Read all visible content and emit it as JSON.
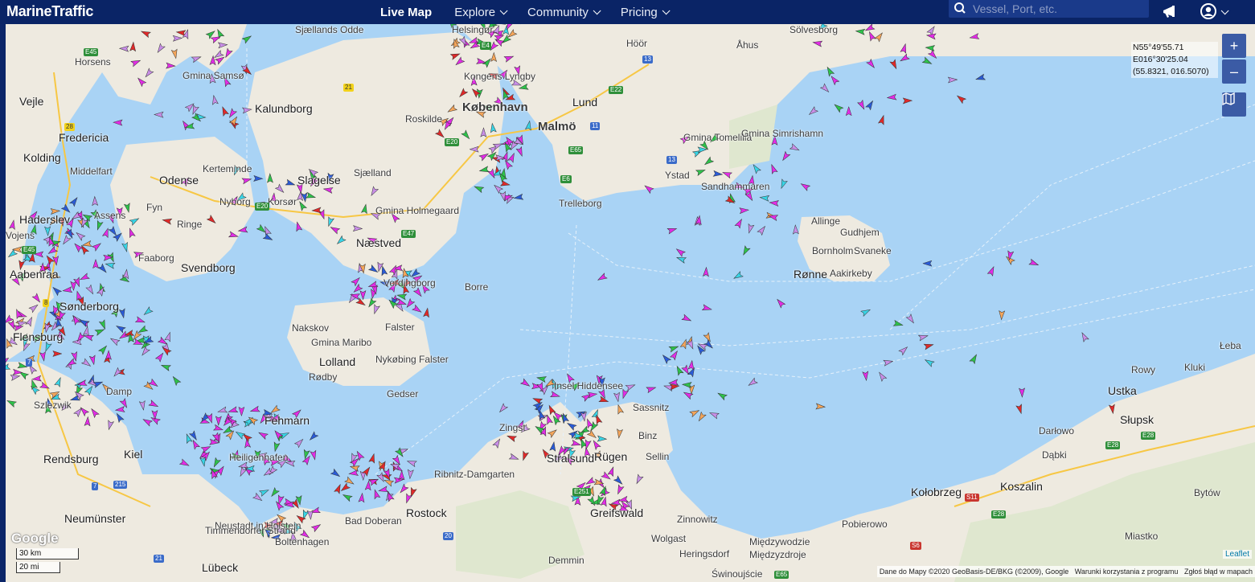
{
  "header": {
    "logo": "MarineTraffic",
    "nav": [
      {
        "label": "Live Map",
        "active": true,
        "caret": false
      },
      {
        "label": "Explore",
        "active": false,
        "caret": true
      },
      {
        "label": "Community",
        "active": false,
        "caret": true
      },
      {
        "label": "Pricing",
        "active": false,
        "caret": true
      }
    ],
    "search_placeholder": "Vessel, Port, etc."
  },
  "map_controls": {
    "zoom_in": "+",
    "zoom_out": "–"
  },
  "coordinates": {
    "lat": "N55°49'55.71",
    "lon": "E016°30'25.04",
    "decimal": "(55.8321, 016.5070)"
  },
  "scale": {
    "km": "30 km",
    "mi": "20 mi"
  },
  "attribution": {
    "data": "Dane do Mapy ©2020 GeoBasis-DE/BKG (©2009), Google",
    "terms": "Warunki korzystania z programu",
    "report": "Zgłoś błąd w mapach",
    "leaflet": "Leaflet",
    "google": "Google"
  },
  "places": [
    "Horsens",
    "Vejle",
    "Fredericia",
    "Kolding",
    "Middelfart",
    "Haderslev",
    "Aabenraa",
    "Sønderborg",
    "Flensburg",
    "Vojens",
    "Odense",
    "Fyn",
    "Nyborg",
    "Ringe",
    "Faaborg",
    "Svendborg",
    "Assens",
    "Kerteminde",
    "Kalundborg",
    "Slagelse",
    "Sjælland",
    "Korsør",
    "Næstved",
    "Gmina Holmegaard",
    "Roskilde",
    "København",
    "Kongens Lyngby",
    "Helsingør",
    "Gmina Samsø",
    "Sjællands Odde",
    "Vordingborg",
    "Falster",
    "Nakskov",
    "Lolland",
    "Gmina Maribo",
    "Nykøbing Falster",
    "Rødby",
    "Borre",
    "Gedser",
    "Malmö",
    "Lund",
    "Trelleborg",
    "Ystad",
    "Gmina Tomelilla",
    "Gmina Simrishamn",
    "Sandhammaren",
    "Höör",
    "Åhus",
    "Sölvesborg",
    "Bornholm",
    "Rønne",
    "Aakirkeby",
    "Svaneke",
    "Allinge",
    "Gudhjem",
    "Rendsburg",
    "Neumünster",
    "Kiel",
    "Szlezwik",
    "Damp",
    "Fehmarn",
    "Heiligenhafen",
    "Neustadt in Holstein",
    "Timmendorfer Strand",
    "Lübeck",
    "Boltenhagen",
    "Rostock",
    "Bad Doberan",
    "Ribnitz-Damgarten",
    "Zingst",
    "Stralsund",
    "Rügen",
    "Insel Hiddensee",
    "Sassnitz",
    "Binz",
    "Sellin",
    "Greifswald",
    "Wolgast",
    "Zinnowitz",
    "Heringsdorf",
    "Demmin",
    "Świnoujście",
    "Międzyzdroje",
    "Międzywodzie",
    "Pobierowo",
    "Kołobrzeg",
    "Koszalin",
    "Darłowo",
    "Dąbki",
    "Słupsk",
    "Ustka",
    "Rowy",
    "Kluki",
    "Łeba",
    "Bytów",
    "Miastko",
    "Sassnitz"
  ],
  "colors": {
    "header": "#0a2466",
    "sea": "#a9d3f5",
    "land": "#eeeae0",
    "cargo": "#2ec24a",
    "tanker": "#e02929",
    "passenger": "#2a5bd7",
    "pleasure": "#e32ce6",
    "fishing": "#f4a55a",
    "tug": "#39d5e6",
    "unknown": "#c98ee8"
  }
}
